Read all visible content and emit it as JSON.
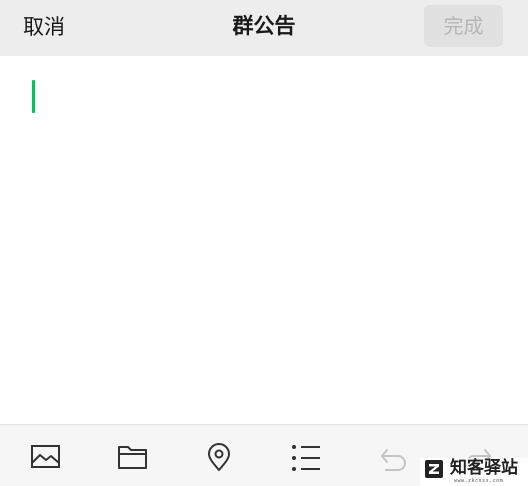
{
  "header": {
    "cancel_label": "取消",
    "title": "群公告",
    "done_label": "完成"
  },
  "editor": {
    "text": "",
    "caret_color": "#07c160"
  },
  "toolbar": {
    "items": [
      {
        "name": "image-icon",
        "enabled": true
      },
      {
        "name": "folder-icon",
        "enabled": true
      },
      {
        "name": "location-pin-icon",
        "enabled": true
      },
      {
        "name": "list-icon",
        "enabled": true
      },
      {
        "name": "undo-icon",
        "enabled": false
      },
      {
        "name": "redo-icon",
        "enabled": false
      }
    ]
  },
  "watermark": {
    "text": "知客驿站",
    "url": "www.zkcsss.com"
  },
  "colors": {
    "header_bg": "#ededed",
    "toolbar_bg": "#f6f6f6",
    "accent": "#07c160",
    "disabled_button_bg": "#e1e1e1",
    "disabled_button_text": "#b6b6b6"
  }
}
